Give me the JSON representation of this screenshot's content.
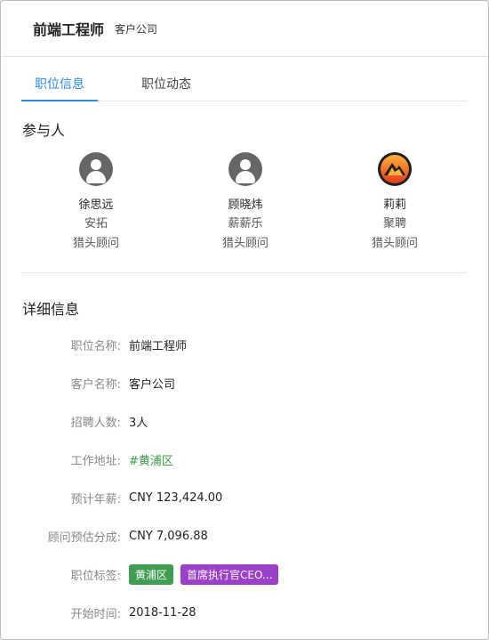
{
  "header": {
    "title": "前端工程师",
    "subtitle": "客户公司"
  },
  "tabs": [
    {
      "label": "职位信息",
      "active": true
    },
    {
      "label": "职位动态",
      "active": false
    }
  ],
  "participants": {
    "title": "参与人",
    "people": [
      {
        "name": "徐思远",
        "company": "安拓",
        "role": "猎头顾问",
        "avatar": "default-user-icon"
      },
      {
        "name": "顾晓炜",
        "company": "薪薪乐",
        "role": "猎头顾问",
        "avatar": "default-user-icon"
      },
      {
        "name": "莉莉",
        "company": "聚聘",
        "role": "猎头顾问",
        "avatar": "company-logo-icon"
      }
    ]
  },
  "details": {
    "title": "详细信息",
    "fields": [
      {
        "label": "职位名称:",
        "value": "前端工程师"
      },
      {
        "label": "客户名称:",
        "value": "客户公司"
      },
      {
        "label": "招聘人数:",
        "value": "3人"
      },
      {
        "label": "工作地址:",
        "value": "#黄浦区"
      },
      {
        "label": "预计年薪:",
        "value": "CNY 123,424.00"
      },
      {
        "label": "顾问预估分成:",
        "value": "CNY 7,096.88"
      },
      {
        "label": "职位标签:",
        "tags": [
          {
            "text": "黄浦区",
            "color": "#3f9e52"
          },
          {
            "text": "首席执行官CEO...",
            "color": "#9c3fc9"
          }
        ]
      },
      {
        "label": "开始时间:",
        "value": "2018-11-28"
      }
    ]
  },
  "colors": {
    "accent": "#2f8ae6",
    "link_green": "#3c9a4a"
  }
}
